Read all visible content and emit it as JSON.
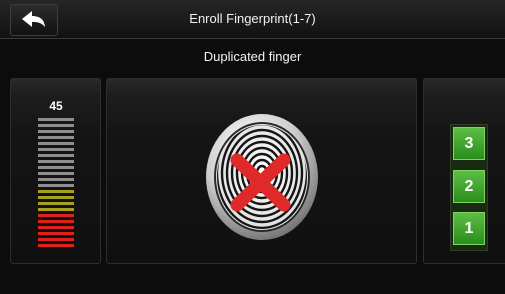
{
  "header": {
    "title": "Enroll Fingerprint(1-7)",
    "back_icon": "back-arrow-icon"
  },
  "status": {
    "message": "Duplicated finger"
  },
  "quality": {
    "value": "45",
    "level_fraction": 0.45,
    "colors": {
      "empty": "#8e8e8e",
      "mid": "#a6a020",
      "low": "#e01f1f"
    }
  },
  "fingerprint": {
    "icon": "fingerprint-icon",
    "result_icon": "red-x-icon",
    "result_color": "#e02a2a"
  },
  "press_count": {
    "buttons": [
      {
        "label": "3"
      },
      {
        "label": "2"
      },
      {
        "label": "1"
      }
    ],
    "accent": "#3ea02a"
  }
}
